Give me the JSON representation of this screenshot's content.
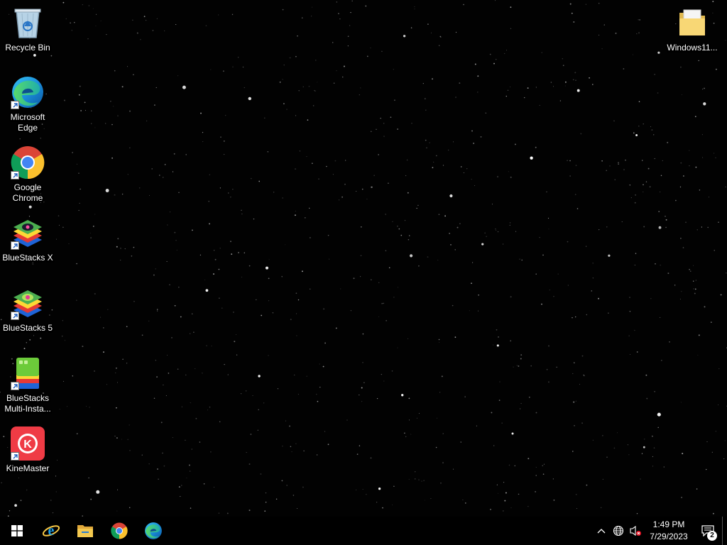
{
  "desktop": {
    "icons_left": [
      {
        "name": "Recycle Bin",
        "label": "Recycle Bin",
        "icon": "recycle-bin-icon"
      },
      {
        "name": "Microsoft Edge",
        "label": "Microsoft\nEdge",
        "icon": "edge-icon"
      },
      {
        "name": "Google Chrome",
        "label": "Google\nChrome",
        "icon": "chrome-icon"
      },
      {
        "name": "BlueStacks X",
        "label": "BlueStacks X",
        "icon": "bluestacks-x-icon"
      },
      {
        "name": "BlueStacks 5",
        "label": "BlueStacks 5",
        "icon": "bluestacks-5-icon"
      },
      {
        "name": "BlueStacks Multi-Instance",
        "label": "BlueStacks\nMulti-Insta...",
        "icon": "bluestacks-multi-instance-icon"
      },
      {
        "name": "KineMaster",
        "label": "KineMaster",
        "icon": "kinemaster-icon"
      }
    ],
    "icons_right": [
      {
        "name": "Windows11 folder",
        "label": "Windows11...",
        "icon": "folder-icon"
      }
    ]
  },
  "taskbar": {
    "start_icon": "windows-start-icon",
    "pinned": [
      {
        "name": "Internet Explorer",
        "icon": "internet-explorer-icon"
      },
      {
        "name": "File Explorer",
        "icon": "file-explorer-icon"
      },
      {
        "name": "Google Chrome",
        "icon": "chrome-icon"
      },
      {
        "name": "Microsoft Edge",
        "icon": "edge-icon"
      }
    ],
    "tray": {
      "chevron_icon": "chevron-up-icon",
      "network_icon": "network-globe-icon",
      "volume_icon": "volume-muted-icon",
      "time": "1:49 PM",
      "date": "7/29/2023",
      "notification_count": "2"
    }
  },
  "colors": {
    "taskbar_bg": "#000000",
    "desktop_bg": "#020202",
    "label_text": "#ffffff"
  }
}
